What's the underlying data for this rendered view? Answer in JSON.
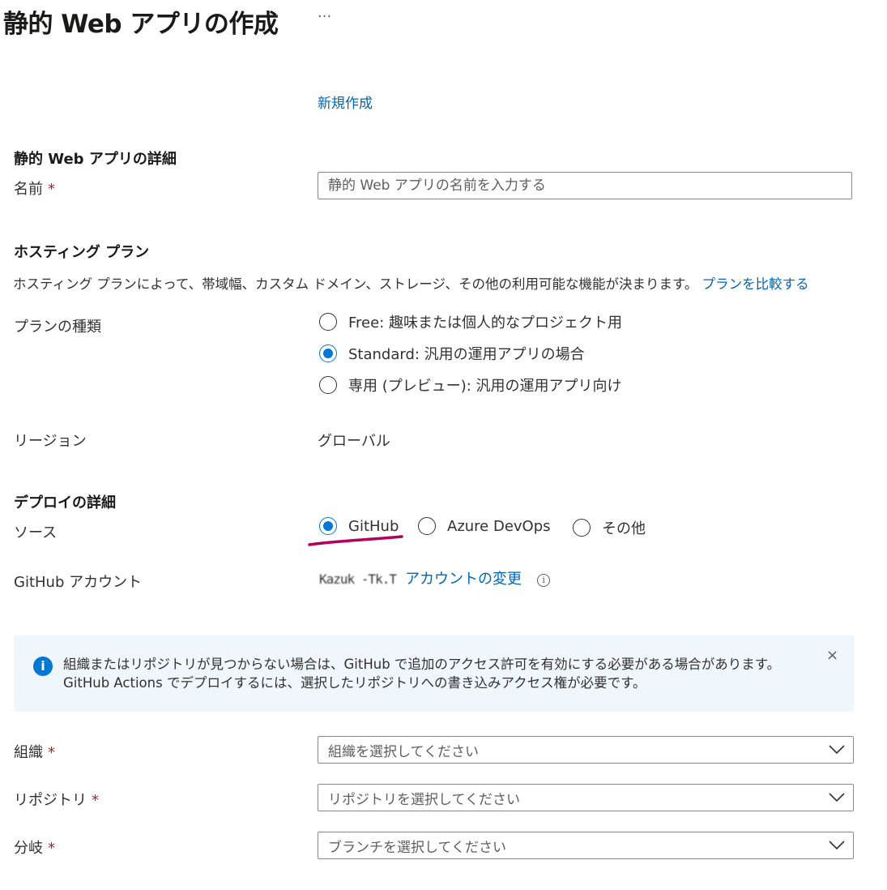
{
  "header": {
    "title": "静的 Web アプリの作成",
    "more_label": "···"
  },
  "new_link": "新規作成",
  "details": {
    "heading": "静的 Web アプリの詳細",
    "name_label": "名前",
    "required_mark": "*",
    "name_placeholder": "静的 Web アプリの名前を入力する",
    "name_value": ""
  },
  "hosting": {
    "heading": "ホスティング プラン",
    "description": "ホスティング プランによって、帯域幅、カスタム ドメイン、ストレージ、その他の利用可能な機能が決まります。",
    "compare_link": "プランを比較する",
    "plan_type_label": "プランの種類",
    "options": [
      {
        "label": "Free: 趣味または個人的なプロジェクト用",
        "selected": false
      },
      {
        "label": "Standard: 汎用の運用アプリの場合",
        "selected": true
      },
      {
        "label": "専用 (プレビュー): 汎用の運用アプリ向け",
        "selected": false
      }
    ],
    "region_label": "リージョン",
    "region_value": "グローバル"
  },
  "deploy": {
    "heading": "デプロイの詳細",
    "source_label": "ソース",
    "sources": [
      {
        "label": "GitHub",
        "selected": true
      },
      {
        "label": "Azure DevOps",
        "selected": false
      },
      {
        "label": "その他",
        "selected": false
      }
    ],
    "account_label": "GitHub アカウント",
    "account_name": "Kazuk -Tk.T",
    "change_account_link": "アカウントの変更",
    "info_icon": "info-circle-icon"
  },
  "info_banner": {
    "text": "組織またはリポジトリが見つからない場合は、GitHub で追加のアクセス許可を有効にする必要がある場合があります。GitHub Actions でデプロイするには、選択したリポジトリへの書き込みアクセス権が必要です。",
    "close_label": "×"
  },
  "fields": {
    "org_label": "組織",
    "org_placeholder": "組織を選択してください",
    "repo_label": "リポジトリ",
    "repo_placeholder": "リポジトリを選択してください",
    "branch_label": "分岐",
    "branch_placeholder": "ブランチを選択してください"
  },
  "colors": {
    "accent": "#0078d4",
    "link": "#0067b8",
    "required": "#a4262c",
    "annotation": "#b4005a",
    "info_bg": "#eff6fc"
  }
}
